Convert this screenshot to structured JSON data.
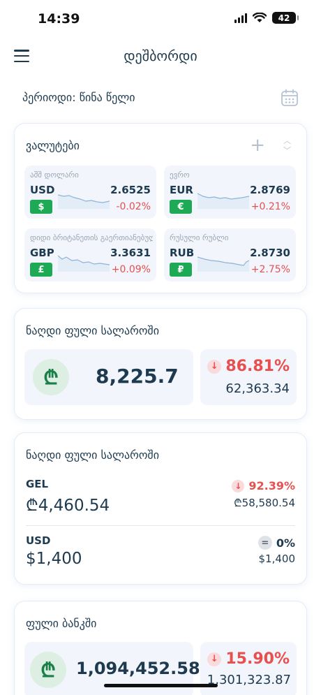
{
  "status_bar": {
    "time": "14:39",
    "battery": "42"
  },
  "header": {
    "title": "დეშბორდი"
  },
  "period": {
    "label": "პერიოდი: წინა წელი"
  },
  "currencies": {
    "title": "ვალუტები",
    "items": [
      {
        "name": "აშშ დოლარი",
        "code": "USD",
        "symbol": "$",
        "rate": "2.6525",
        "change": "-0.02%"
      },
      {
        "name": "ევრო",
        "code": "EUR",
        "symbol": "€",
        "rate": "2.8769",
        "change": "+0.21%"
      },
      {
        "name": "დიდი ბრიტანეთის გაერთიანებული სამეფოს ფუნტი",
        "code": "GBP",
        "symbol": "£",
        "rate": "3.3631",
        "change": "+0.09%"
      },
      {
        "name": "რუსული რუბლი",
        "code": "RUB",
        "symbol": "₽",
        "rate": "2.8730",
        "change": "+2.75%"
      }
    ]
  },
  "cash_box": {
    "title": "ნაღდი ფული სალაროში",
    "amount": "8,225.7",
    "currency_symbol": "₾",
    "percent": "86.81%",
    "previous": "62,363.34"
  },
  "cash_by_currency": {
    "title": "ნაღდი ფული სალაროში",
    "rows": [
      {
        "code": "GEL",
        "amount": "₾4,460.54",
        "percent": "92.39%",
        "previous": "₾58,580.54"
      },
      {
        "code": "USD",
        "amount": "$1,400",
        "percent": "0%",
        "previous": "$1,400"
      }
    ]
  },
  "bank": {
    "title": "ფული ბანკში",
    "amount": "1,094,452.58",
    "currency_symbol": "₾",
    "percent": "15.90%",
    "previous": "1,301,323.87"
  },
  "colors": {
    "accent_green": "#1eaa55",
    "negative_red": "#e84f4f",
    "text_navy": "#1d3a4f"
  }
}
